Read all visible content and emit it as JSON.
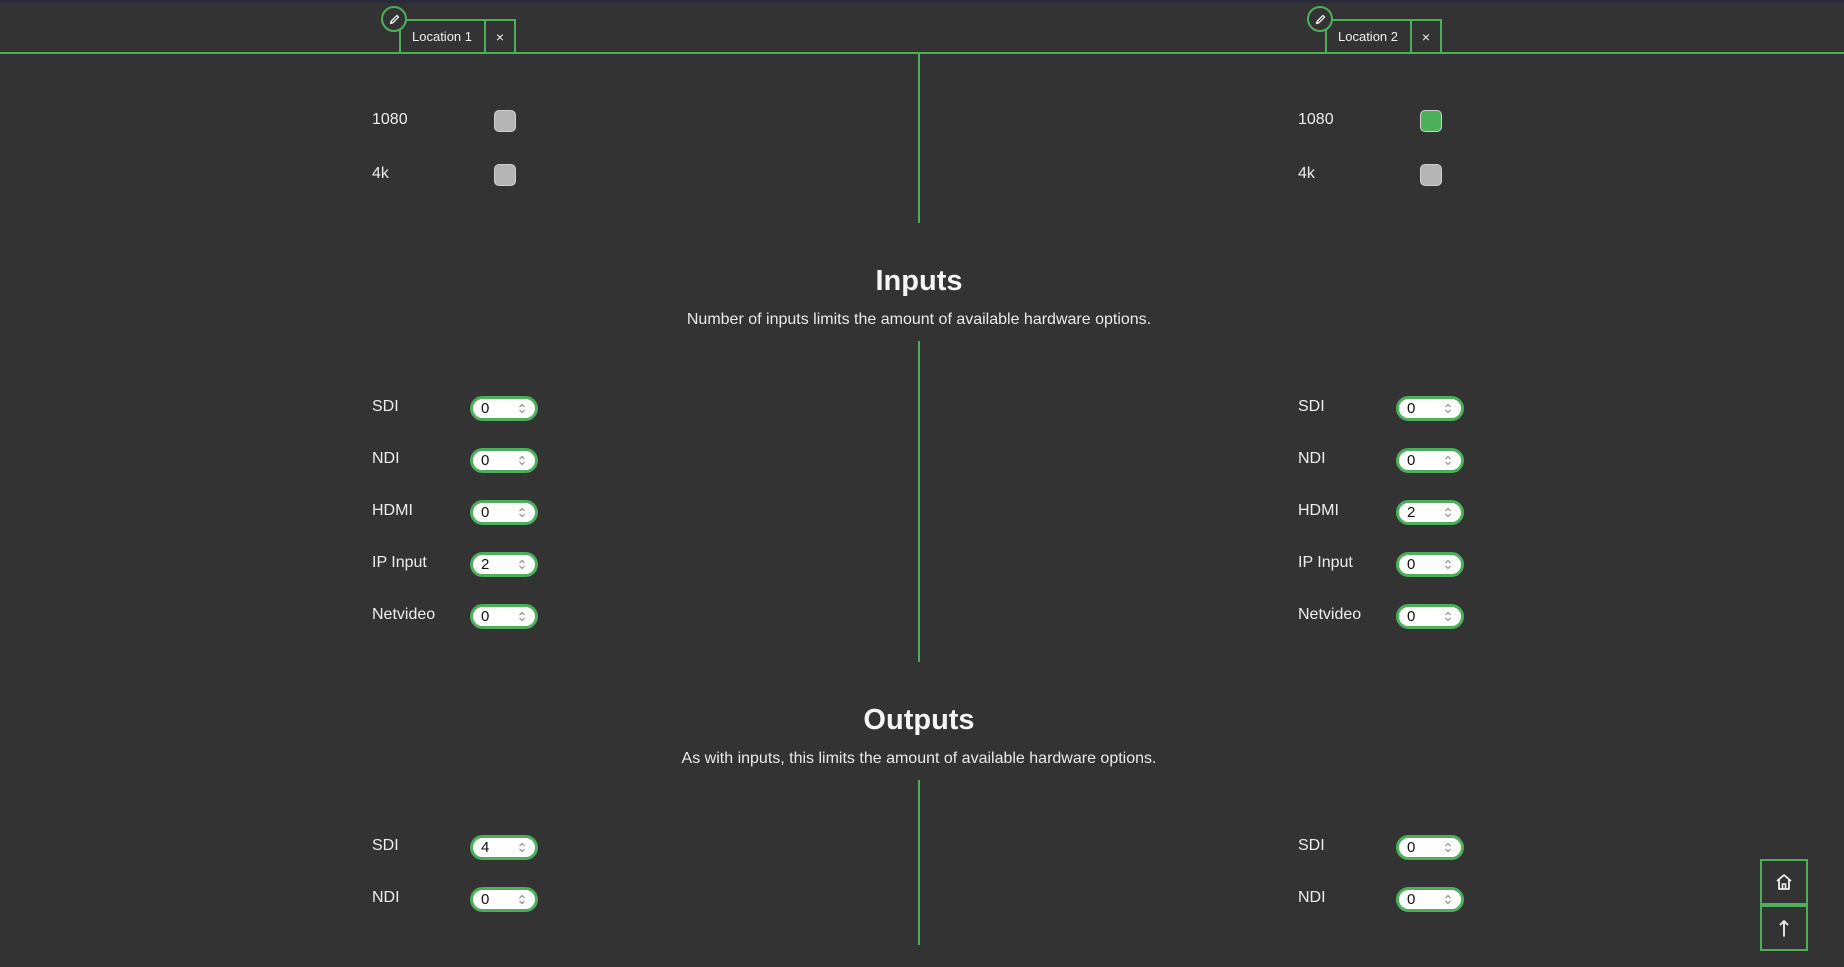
{
  "tabs": [
    {
      "label": "Location 1",
      "close": "×"
    },
    {
      "label": "Location 2",
      "close": "×"
    }
  ],
  "resolution": {
    "rows": [
      "1080",
      "4k"
    ],
    "location1": {
      "1080": false,
      "4k": false
    },
    "location2": {
      "1080": true,
      "4k": false
    }
  },
  "inputs": {
    "title": "Inputs",
    "subtitle": "Number of inputs limits the amount of available hardware options.",
    "labels": [
      "SDI",
      "NDI",
      "HDMI",
      "IP Input",
      "Netvideo"
    ],
    "location1": [
      "0",
      "0",
      "0",
      "2",
      "0"
    ],
    "location2": [
      "0",
      "0",
      "2",
      "0",
      "0"
    ]
  },
  "outputs": {
    "title": "Outputs",
    "subtitle": "As with inputs, this limits the amount of available hardware options.",
    "labels": [
      "SDI",
      "NDI"
    ],
    "location1": [
      "4",
      "0"
    ],
    "location2": [
      "0",
      "0"
    ]
  },
  "icons": {
    "edit": "pencil-icon",
    "home": "home-icon",
    "top": "arrow-up-icon"
  },
  "colors": {
    "accent": "#4caf5a",
    "background": "#333333",
    "checkbox_off": "#b4b4b4"
  }
}
